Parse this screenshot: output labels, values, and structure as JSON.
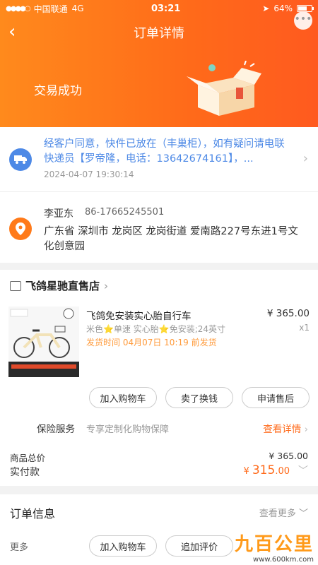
{
  "status_bar": {
    "carrier": "中国联通",
    "network": "4G",
    "time": "03:21",
    "battery": "64%",
    "battery_level": 0.64
  },
  "nav": {
    "title": "订单详情",
    "more": "•••"
  },
  "order_status": "交易成功",
  "logistics": {
    "text": "经客户同意，快件已放在（丰巢柜），如有疑问请电联快递员【罗帝隆，电话：13642674161】，...",
    "time": "2024-04-07 19:30:14"
  },
  "address": {
    "name": "李亚东",
    "phone": "86-17665245501",
    "line": "广东省 深圳市 龙岗区 龙岗街道 爱南路227号东进1号文化创意园"
  },
  "shop": {
    "name": "飞鸽星驰直售店",
    "product": {
      "title": "飞鸽免安装实心胎自行车",
      "spec": "米色⭐单速 实心胎⭐免安装;24英寸",
      "ship_time": "发货时间 04月07日 10:19 前发货",
      "price": "¥ 365.00",
      "qty": "x1"
    },
    "buttons": [
      "加入购物车",
      "卖了换钱",
      "申请售后"
    ],
    "insurance": {
      "label": "保险服务",
      "desc": "专享定制化购物保障",
      "link": "查看详情"
    },
    "total_label": "商品总价",
    "total_value": "¥ 365.00",
    "paid_label": "实付款",
    "paid_prefix": "¥ ",
    "paid_int": "315",
    "paid_dec": ".00"
  },
  "order_info": {
    "title": "订单信息",
    "more": "查看更多"
  },
  "footer": {
    "more": "更多",
    "buttons": [
      "加入购物车",
      "追加评价"
    ]
  },
  "watermark": {
    "main": "九百公里",
    "sub": "www.600km.com"
  },
  "colors": {
    "accent": "#ff6a1a",
    "link_blue": "#4d89e6",
    "ship_orange": "#ff9a3a"
  }
}
